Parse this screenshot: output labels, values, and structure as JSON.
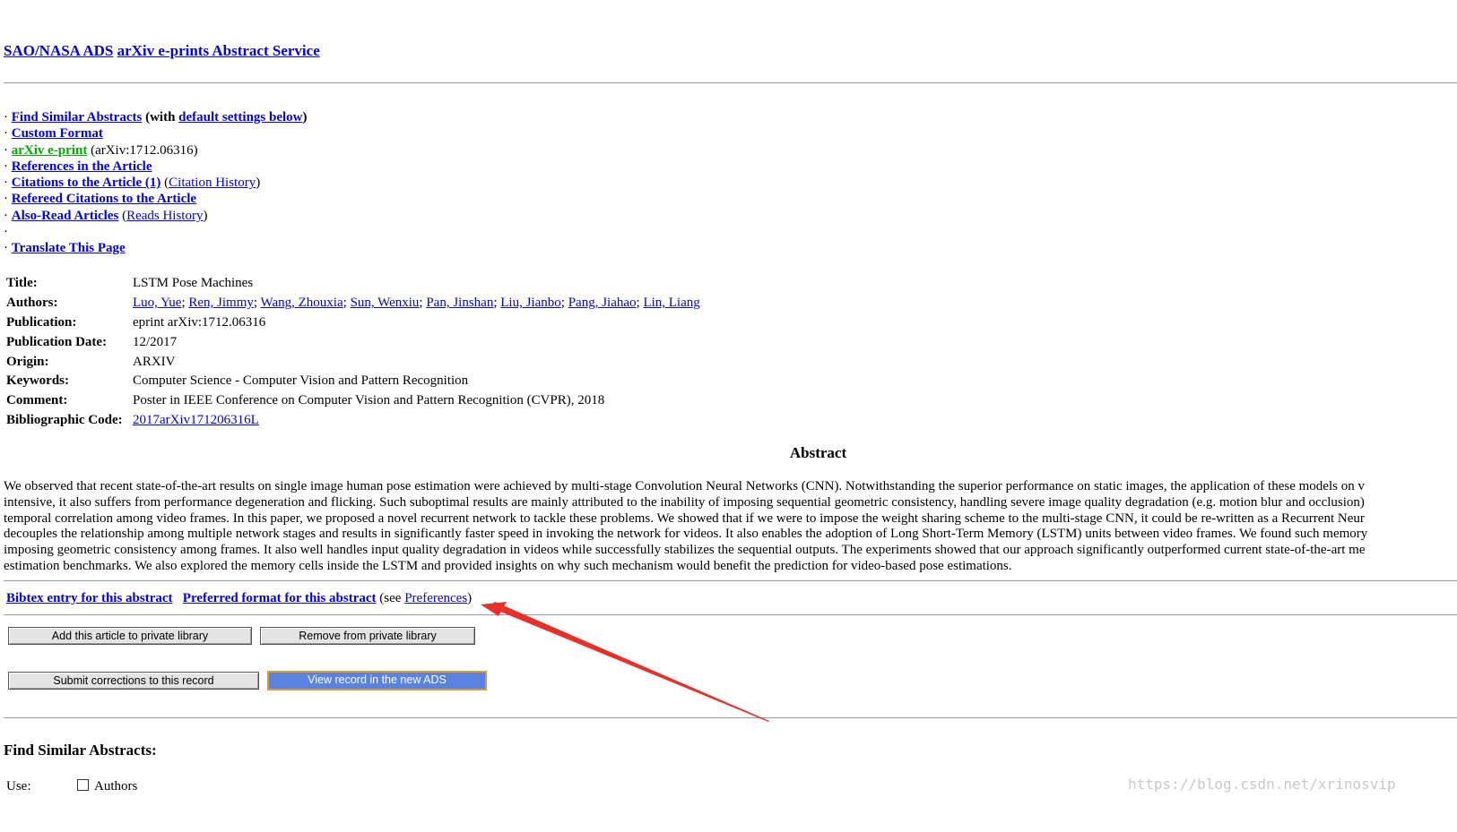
{
  "header": {
    "ads_link": "SAO/NASA ADS",
    "service_link": "arXiv e-prints Abstract Service"
  },
  "links": {
    "find_similar": "Find Similar Abstracts",
    "with_open": "(with",
    "default_settings": "default settings below",
    "with_close": ")",
    "custom_format": "Custom Format",
    "arxiv_eprint": "arXiv e-print",
    "arxiv_id": "(arXiv:1712.06316)",
    "references": "References in the Article",
    "citations": "Citations to the Article (1)",
    "citation_history": "Citation History",
    "refereed_citations": "Refereed Citations to the Article",
    "also_read": "Also-Read Articles",
    "reads_history": "Reads History",
    "translate": "Translate This Page"
  },
  "meta": {
    "title_label": "Title:",
    "title": "LSTM Pose Machines",
    "authors_label": "Authors:",
    "authors": [
      "Luo, Yue",
      "Ren, Jimmy",
      "Wang, Zhouxia",
      "Sun, Wenxiu",
      "Pan, Jinshan",
      "Liu, Jianbo",
      "Pang, Jiahao",
      "Lin, Liang"
    ],
    "publication_label": "Publication:",
    "publication": "eprint arXiv:1712.06316",
    "pubdate_label": "Publication Date:",
    "pubdate": "12/2017",
    "origin_label": "Origin:",
    "origin": "ARXIV",
    "keywords_label": "Keywords:",
    "keywords": "Computer Science - Computer Vision and Pattern Recognition",
    "comment_label": "Comment:",
    "comment": "Poster in IEEE Conference on Computer Vision and Pattern Recognition (CVPR), 2018",
    "bibcode_label": "Bibliographic Code:",
    "bibcode": "2017arXiv171206316L"
  },
  "abstract": {
    "heading": "Abstract",
    "lines": [
      "We observed that recent state-of-the-art results on single image human pose estimation were achieved by multi-stage Convolution Neural Networks (CNN). Notwithstanding the superior performance on static images, the application of these models on v",
      "intensive, it also suffers from performance degeneration and flicking. Such suboptimal results are mainly attributed to the inability of imposing sequential geometric consistency, handling severe image quality degradation (e.g. motion blur and occlusion)",
      "temporal correlation among video frames. In this paper, we proposed a novel recurrent network to tackle these problems. We showed that if we were to impose the weight sharing scheme to the multi-stage CNN, it could be re-written as a Recurrent Neur",
      "decouples the relationship among multiple network stages and results in significantly faster speed in invoking the network for videos. It also enables the adoption of Long Short-Term Memory (LSTM) units between video frames. We found such memory",
      "imposing geometric consistency among frames. It also well handles input quality degradation in videos while successfully stabilizes the sequential outputs. The experiments showed that our approach significantly outperformed current state-of-the-art me",
      "estimation benchmarks. We also explored the memory cells inside the LSTM and provided insights on why such mechanism would benefit the prediction for video-based pose estimations."
    ]
  },
  "bottom_links": {
    "bibtex": "Bibtex entry for this abstract",
    "preferred": "Preferred format for this abstract",
    "see_open": "(see",
    "preferences": "Preferences",
    "see_close": ")"
  },
  "buttons": {
    "add_private": "Add this article to private library",
    "remove_private": "Remove from private library",
    "submit_corrections": "Submit corrections to this record",
    "view_new_ads": "View record in the new ADS"
  },
  "find_similar": {
    "heading": "Find Similar Abstracts:",
    "use_label": "Use:",
    "authors_option": "Authors"
  },
  "annotation": {
    "arrow_color": "#e8302a"
  },
  "watermark": "https://blog.csdn.net/xrinosvip"
}
